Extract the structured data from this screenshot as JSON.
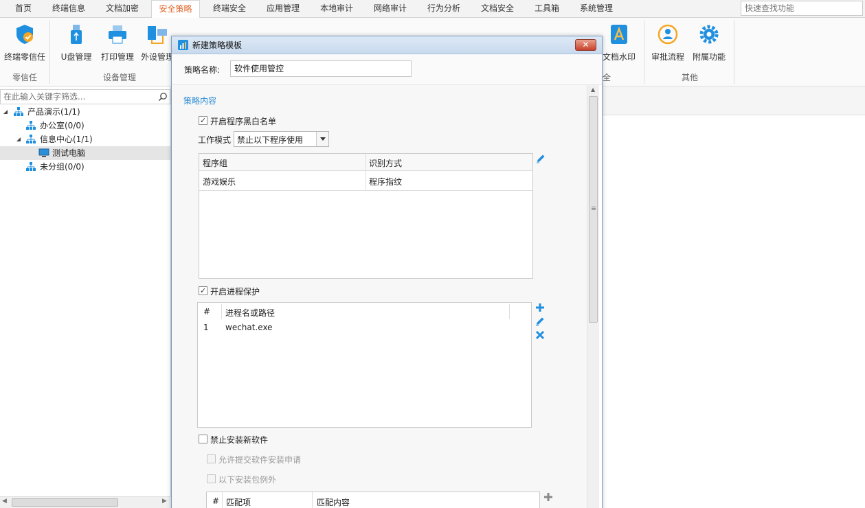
{
  "menu": {
    "tabs": [
      "首页",
      "终端信息",
      "文档加密",
      "安全策略",
      "终端安全",
      "应用管理",
      "本地审计",
      "网络审计",
      "行为分析",
      "文档安全",
      "工具箱",
      "系统管理"
    ],
    "active_tab": "安全策略",
    "search_placeholder": "快速查找功能"
  },
  "ribbon": {
    "buttons": [
      {
        "label": "终端零信任",
        "icon": "shield-check-icon"
      },
      {
        "label": "U盘管理",
        "icon": "usb-drive-icon"
      },
      {
        "label": "打印管理",
        "icon": "printer-icon"
      },
      {
        "label": "外设管理",
        "icon": "peripheral-icon"
      },
      {
        "label": "文档水印",
        "icon": "watermark-icon"
      },
      {
        "label": "审批流程",
        "icon": "approval-flow-icon"
      },
      {
        "label": "附属功能",
        "icon": "gear-icon"
      }
    ],
    "groups": [
      "零信任",
      "设备管理",
      "全",
      "其他"
    ]
  },
  "sidebar": {
    "filter_placeholder": "在此输入关键字筛选...",
    "tree": [
      {
        "label": "产品演示(1/1)",
        "level": 0,
        "expanded": true
      },
      {
        "label": "办公室(0/0)",
        "level": 1
      },
      {
        "label": "信息中心(1/1)",
        "level": 1,
        "expanded": true
      },
      {
        "label": "测试电脑",
        "level": 2,
        "selected": true
      },
      {
        "label": "未分组(0/0)",
        "level": 1
      }
    ]
  },
  "dialog": {
    "title": "新建策略模板",
    "close_label": "✕",
    "name_label": "策略名称:",
    "name_value": "软件使用管控",
    "section_title": "策略内容",
    "blackwhite": {
      "checkbox_label": "开启程序黑白名单",
      "checked": true,
      "mode_label": "工作模式",
      "mode_value": "禁止以下程序使用",
      "columns": [
        "程序组",
        "识别方式"
      ],
      "rows": [
        [
          "游戏娱乐",
          "程序指纹"
        ]
      ]
    },
    "process_protect": {
      "checkbox_label": "开启进程保护",
      "checked": true,
      "columns": [
        "#",
        "进程名或路径"
      ],
      "rows": [
        [
          "1",
          "wechat.exe"
        ]
      ]
    },
    "forbid_install": {
      "checkbox_label": "禁止安装新软件",
      "checked": false,
      "allow_submit_label": "允许提交软件安装申请",
      "exceptions_label": "以下安装包例外",
      "columns": [
        "#",
        "匹配项",
        "匹配内容"
      ]
    }
  },
  "colors": {
    "accent": "#2a8ad4",
    "active_tab": "#e0662a",
    "icon_blue": "#1f8fe0"
  }
}
